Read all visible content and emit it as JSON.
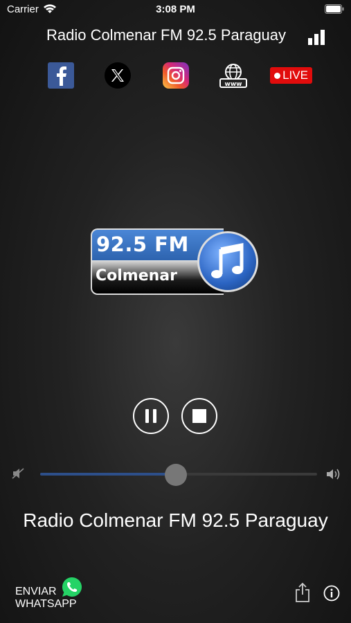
{
  "status_bar": {
    "carrier": "Carrier",
    "time": "3:08 PM"
  },
  "header": {
    "title": "Radio Colmenar FM 92.5 Paraguay"
  },
  "social": {
    "live_label": "LIVE"
  },
  "logo": {
    "frequency": "92.5 FM",
    "name": "Colmenar"
  },
  "player": {
    "volume": 0.49
  },
  "now_playing": {
    "station": "Radio Colmenar FM 92.5 Paraguay"
  },
  "footer": {
    "whatsapp_line1": "ENVIAR",
    "whatsapp_line2": "WHATSAPP"
  },
  "colors": {
    "facebook": "#3b5998",
    "live": "#e10c0c",
    "slider_fill": "#2d4f8a"
  }
}
